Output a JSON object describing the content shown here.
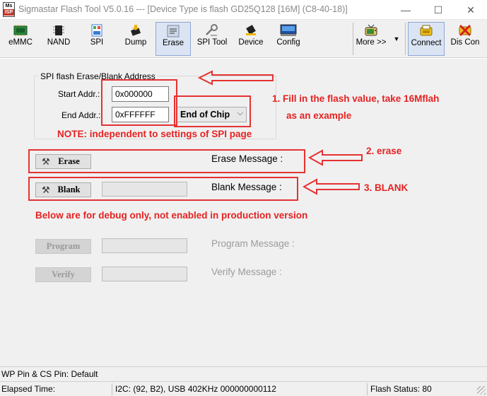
{
  "window": {
    "title": "Sigmastar Flash Tool V5.0.16 --- [Device Type is flash GD25Q128 [16M] (C8-40-18)]",
    "icon_text_top": "Ms",
    "icon_text_bottom": "ISP",
    "controls": {
      "minimize": "—",
      "maximize": "☐",
      "close": "✕"
    }
  },
  "toolbar": {
    "emmc": "eMMC",
    "nand": "NAND",
    "spi": "SPI",
    "dump": "Dump",
    "erase": "Erase",
    "spi_tool": "SPI Tool",
    "device": "Device",
    "config": "Config",
    "more": "More >>",
    "more_arrow": "▼",
    "connect": "Connect",
    "disconnect": "Dis Con"
  },
  "erase_panel": {
    "group_title": "SPI flash Erase/Blank Address",
    "start_label": "Start Addr.:",
    "start_value": "0x000000",
    "end_label": "End Addr.:",
    "end_value": "0xFFFFFF",
    "end_option": "End of Chip",
    "end_option_arrow": "⌵",
    "erase_button": "Erase",
    "erase_message_label": "Erase Message :",
    "blank_button": "Blank",
    "blank_message_label": "Blank Message :",
    "program_button": "Program",
    "program_message_label": "Program Message :",
    "verify_button": "Verify",
    "verify_message_label": "Verify Message :"
  },
  "annotations": {
    "note": "NOTE: independent to settings of SPI page",
    "step1_line1": "1.  Fill in the flash value, take 16Mflah",
    "step1_line2": "as an example",
    "step2": "2. erase",
    "step3": "3. BLANK",
    "debug_note": "Below are for debug only, not enabled in production version",
    "color": "#e52222"
  },
  "status": {
    "pins": "WP Pin & CS Pin: Default",
    "elapsed": "Elapsed Time:",
    "i2c": "I2C: (92, B2), USB  402KHz 000000000112",
    "flash_status": "Flash Status: 80"
  }
}
